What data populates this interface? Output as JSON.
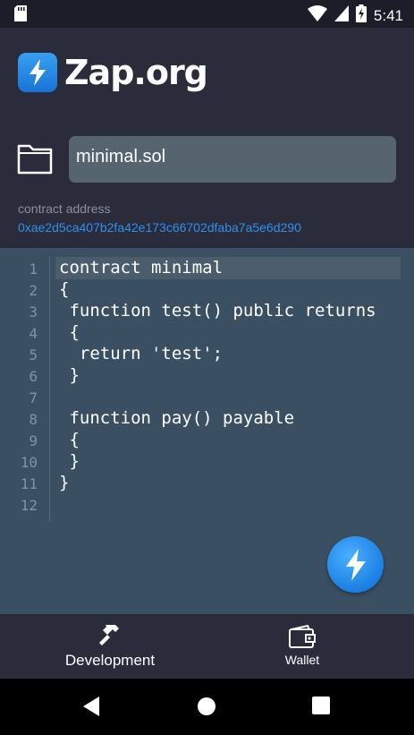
{
  "status_bar": {
    "time": "5:41",
    "icons": [
      "sd-card-icon",
      "wifi-icon",
      "cellular-icon",
      "battery-charging-icon"
    ]
  },
  "app": {
    "name": "Zap.org",
    "brand_color": "#1e86eb"
  },
  "file": {
    "name": "minimal.sol"
  },
  "contract": {
    "address_label": "contract address",
    "address": "0xae2d5ca407b2fa42e173c66702dfaba7a5e6d290"
  },
  "editor": {
    "line_numbers": [
      "1",
      "2",
      "3",
      "4",
      "5",
      "6",
      "7",
      "8",
      "9",
      "10",
      "11",
      "12"
    ],
    "lines": [
      "contract minimal",
      "{",
      " function test() public returns",
      " {",
      "  return 'test';",
      " }",
      "",
      " function pay() payable",
      " {",
      " }",
      "}",
      ""
    ]
  },
  "bottom_nav": {
    "items": [
      {
        "label": "Development",
        "icon": "hammer-icon"
      },
      {
        "label": "Wallet",
        "icon": "wallet-icon"
      }
    ]
  },
  "system_nav": {
    "icons": [
      "back-icon",
      "home-icon",
      "recents-icon"
    ]
  }
}
